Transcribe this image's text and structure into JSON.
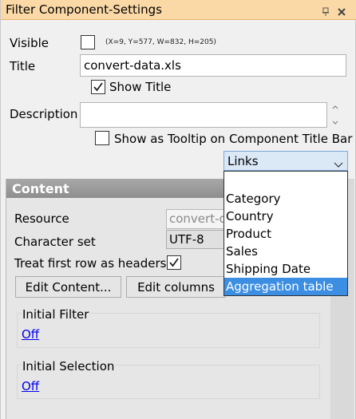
{
  "window": {
    "title": "Filter Component-Settings",
    "pin_icon": "pin-icon",
    "close_icon": "close-icon",
    "titlebar_color": "#fbd9a6"
  },
  "settings": {
    "visible_label": "Visible",
    "visible_checked": false,
    "geometry_note": "(X=9, Y=577, W=832, H=205)",
    "title_label": "Title",
    "title_value": "convert-data.xls",
    "show_title_label": "Show Title",
    "show_title_checked": true,
    "description_label": "Description",
    "description_value": "",
    "tooltip_label": "Show as Tooltip on Component Title Bar",
    "tooltip_checked": false,
    "alignment_selected": "Links"
  },
  "dropdown": {
    "options": [
      "",
      "Category",
      "Country",
      "Product",
      "Sales",
      "Shipping Date",
      "Aggregation table"
    ],
    "selected_index": 6,
    "highlight_color": "#3c8ee3"
  },
  "content": {
    "header": "Content",
    "resource_label": "Resource",
    "resource_value": "convert-data.xls",
    "charset_label": "Character set",
    "charset_value": "UTF-8",
    "headers_label": "Treat first row as headers",
    "headers_checked": true,
    "edit_content_button": "Edit Content...",
    "edit_columns_button": "Edit columns",
    "initial_filter_label": "Initial Filter",
    "initial_filter_value": "Off",
    "initial_selection_label": "Initial Selection",
    "initial_selection_value": "Off"
  }
}
